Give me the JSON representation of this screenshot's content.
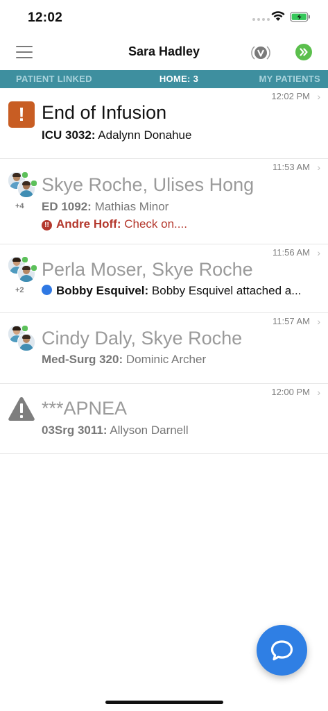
{
  "status_bar": {
    "time": "12:02"
  },
  "nav": {
    "title": "Sara Hadley"
  },
  "tabs": [
    {
      "label": "PATIENT LINKED"
    },
    {
      "label": "HOME: 3"
    },
    {
      "label": "MY PATIENTS"
    }
  ],
  "active_tab": 1,
  "rows": [
    {
      "time": "12:02 PM",
      "title": "End of Infusion",
      "sub_bold": "ICU 3032:",
      "sub_text": "Adalynn Donahue",
      "icon": "alert-orange-icon"
    },
    {
      "time": "11:53 AM",
      "title": "Skye Roche, Ulises Hong",
      "sub_bold": "ED 1092:",
      "sub_text": "Mathias Minor",
      "count": "+4",
      "msg_sender": "Andre Hoff:",
      "msg_text": "Check on....",
      "msg_icon": "urgent-icon"
    },
    {
      "time": "11:56 AM",
      "title": "Perla Moser, Skye Roche",
      "msg_sender": "Bobby Esquivel:",
      "msg_text": "Bobby Esquivel attached a...",
      "count": "+2",
      "msg_icon": "unread-dot-icon"
    },
    {
      "time": "11:57 AM",
      "title": "Cindy Daly, Skye Roche",
      "sub_bold": "Med-Surg 320:",
      "sub_text": "Dominic Archer"
    },
    {
      "time": "12:00 PM",
      "title": "***APNEA",
      "sub_bold": "03Srg 3011:",
      "sub_text": "Allyson Darnell",
      "icon": "warning-triangle-icon"
    }
  ],
  "colors": {
    "tab_bar": "#3e8f9f",
    "fab": "#2f7fe4",
    "urgent": "#b4382d",
    "alert_orange": "#c85d23",
    "online": "#5cc05a"
  }
}
